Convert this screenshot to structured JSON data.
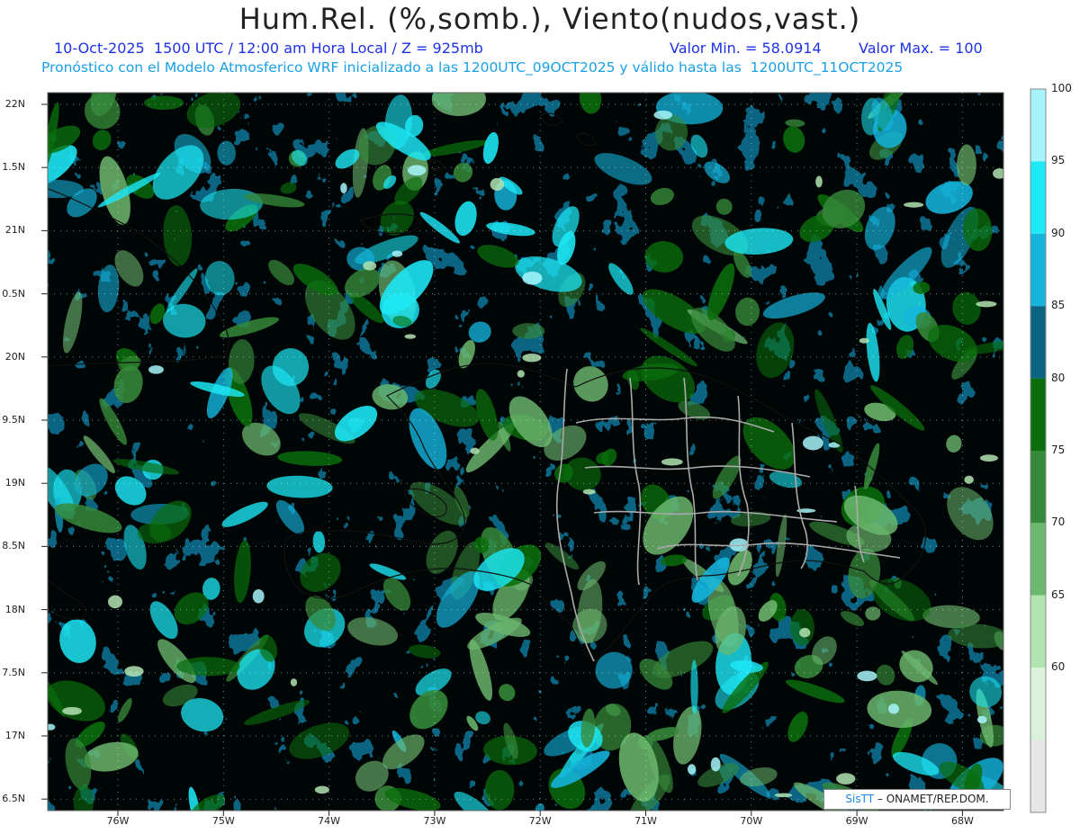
{
  "header": {
    "title": "Hum.Rel. (%,somb.), Viento(nudos,vast.)",
    "datetime": "10-Oct-2025  1500 UTC / 12:00 am Hora Local / Z = 925mb",
    "vmin": "Valor Min. = 58.0914",
    "vmax": "Valor Max. = 100",
    "model_info": "Pronóstico con el Modelo Atmosferico WRF inicializado a las 1200UTC_09OCT2025 y válido hasta las  1200UTC_11OCT2025"
  },
  "axes": {
    "lat_labels": [
      "22N",
      "1.5N",
      "21N",
      "0.5N",
      "20N",
      "9.5N",
      "19N",
      "8.5N",
      "18N",
      "7.5N",
      "17N",
      "6.5N"
    ],
    "lon_labels": [
      "76W",
      "75W",
      "74W",
      "73W",
      "72W",
      "71W",
      "70W",
      "69W",
      "68W"
    ]
  },
  "colorbar": {
    "labels": [
      "100",
      "95",
      "90",
      "85",
      "80",
      "75",
      "70",
      "65",
      "60"
    ],
    "bins": [
      {
        "from": 95,
        "to": 100,
        "color": "#a6f4fa"
      },
      {
        "from": 90,
        "to": 95,
        "color": "#1ce8f6"
      },
      {
        "from": 85,
        "to": 90,
        "color": "#14b4dc"
      },
      {
        "from": 80,
        "to": 85,
        "color": "#0a6482"
      },
      {
        "from": 75,
        "to": 80,
        "color": "#0a6e0c"
      },
      {
        "from": 70,
        "to": 75,
        "color": "#36893a"
      },
      {
        "from": 65,
        "to": 70,
        "color": "#6cb86e"
      },
      {
        "from": 60,
        "to": 65,
        "color": "#b2e4b2"
      },
      {
        "from": 55,
        "to": 60,
        "color": "#daf2da"
      },
      {
        "from": 50,
        "to": 55,
        "color": "#e6e6e6"
      }
    ]
  },
  "credit": {
    "logo": "SisTT",
    "text": "– ONAMET/REP.DOM."
  }
}
